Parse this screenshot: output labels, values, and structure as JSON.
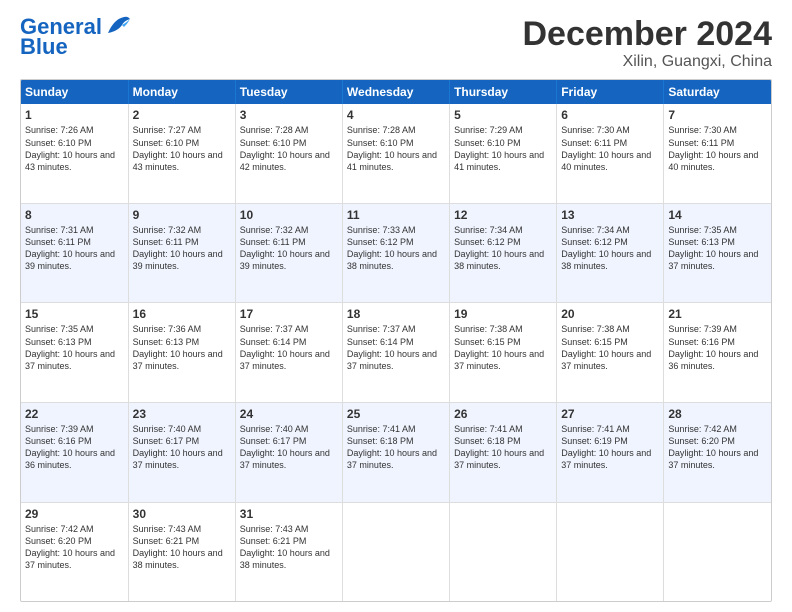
{
  "logo": {
    "line1": "General",
    "line2": "Blue"
  },
  "title": "December 2024",
  "subtitle": "Xilin, Guangxi, China",
  "days": [
    "Sunday",
    "Monday",
    "Tuesday",
    "Wednesday",
    "Thursday",
    "Friday",
    "Saturday"
  ],
  "weeks": [
    [
      {
        "num": "1",
        "rise": "7:26 AM",
        "set": "6:10 PM",
        "daylight": "10 hours and 43 minutes."
      },
      {
        "num": "2",
        "rise": "7:27 AM",
        "set": "6:10 PM",
        "daylight": "10 hours and 43 minutes."
      },
      {
        "num": "3",
        "rise": "7:28 AM",
        "set": "6:10 PM",
        "daylight": "10 hours and 42 minutes."
      },
      {
        "num": "4",
        "rise": "7:28 AM",
        "set": "6:10 PM",
        "daylight": "10 hours and 41 minutes."
      },
      {
        "num": "5",
        "rise": "7:29 AM",
        "set": "6:10 PM",
        "daylight": "10 hours and 41 minutes."
      },
      {
        "num": "6",
        "rise": "7:30 AM",
        "set": "6:11 PM",
        "daylight": "10 hours and 40 minutes."
      },
      {
        "num": "7",
        "rise": "7:30 AM",
        "set": "6:11 PM",
        "daylight": "10 hours and 40 minutes."
      }
    ],
    [
      {
        "num": "8",
        "rise": "7:31 AM",
        "set": "6:11 PM",
        "daylight": "10 hours and 39 minutes."
      },
      {
        "num": "9",
        "rise": "7:32 AM",
        "set": "6:11 PM",
        "daylight": "10 hours and 39 minutes."
      },
      {
        "num": "10",
        "rise": "7:32 AM",
        "set": "6:11 PM",
        "daylight": "10 hours and 39 minutes."
      },
      {
        "num": "11",
        "rise": "7:33 AM",
        "set": "6:12 PM",
        "daylight": "10 hours and 38 minutes."
      },
      {
        "num": "12",
        "rise": "7:34 AM",
        "set": "6:12 PM",
        "daylight": "10 hours and 38 minutes."
      },
      {
        "num": "13",
        "rise": "7:34 AM",
        "set": "6:12 PM",
        "daylight": "10 hours and 38 minutes."
      },
      {
        "num": "14",
        "rise": "7:35 AM",
        "set": "6:13 PM",
        "daylight": "10 hours and 37 minutes."
      }
    ],
    [
      {
        "num": "15",
        "rise": "7:35 AM",
        "set": "6:13 PM",
        "daylight": "10 hours and 37 minutes."
      },
      {
        "num": "16",
        "rise": "7:36 AM",
        "set": "6:13 PM",
        "daylight": "10 hours and 37 minutes."
      },
      {
        "num": "17",
        "rise": "7:37 AM",
        "set": "6:14 PM",
        "daylight": "10 hours and 37 minutes."
      },
      {
        "num": "18",
        "rise": "7:37 AM",
        "set": "6:14 PM",
        "daylight": "10 hours and 37 minutes."
      },
      {
        "num": "19",
        "rise": "7:38 AM",
        "set": "6:15 PM",
        "daylight": "10 hours and 37 minutes."
      },
      {
        "num": "20",
        "rise": "7:38 AM",
        "set": "6:15 PM",
        "daylight": "10 hours and 37 minutes."
      },
      {
        "num": "21",
        "rise": "7:39 AM",
        "set": "6:16 PM",
        "daylight": "10 hours and 36 minutes."
      }
    ],
    [
      {
        "num": "22",
        "rise": "7:39 AM",
        "set": "6:16 PM",
        "daylight": "10 hours and 36 minutes."
      },
      {
        "num": "23",
        "rise": "7:40 AM",
        "set": "6:17 PM",
        "daylight": "10 hours and 37 minutes."
      },
      {
        "num": "24",
        "rise": "7:40 AM",
        "set": "6:17 PM",
        "daylight": "10 hours and 37 minutes."
      },
      {
        "num": "25",
        "rise": "7:41 AM",
        "set": "6:18 PM",
        "daylight": "10 hours and 37 minutes."
      },
      {
        "num": "26",
        "rise": "7:41 AM",
        "set": "6:18 PM",
        "daylight": "10 hours and 37 minutes."
      },
      {
        "num": "27",
        "rise": "7:41 AM",
        "set": "6:19 PM",
        "daylight": "10 hours and 37 minutes."
      },
      {
        "num": "28",
        "rise": "7:42 AM",
        "set": "6:20 PM",
        "daylight": "10 hours and 37 minutes."
      }
    ],
    [
      {
        "num": "29",
        "rise": "7:42 AM",
        "set": "6:20 PM",
        "daylight": "10 hours and 37 minutes."
      },
      {
        "num": "30",
        "rise": "7:43 AM",
        "set": "6:21 PM",
        "daylight": "10 hours and 38 minutes."
      },
      {
        "num": "31",
        "rise": "7:43 AM",
        "set": "6:21 PM",
        "daylight": "10 hours and 38 minutes."
      },
      null,
      null,
      null,
      null
    ]
  ]
}
